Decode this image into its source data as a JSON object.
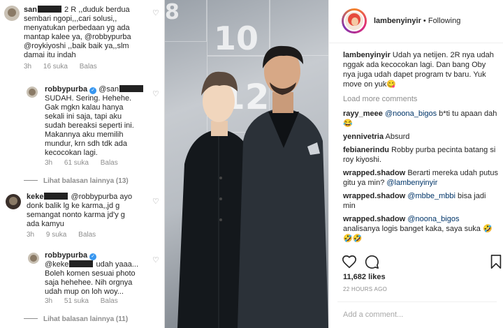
{
  "left_comments": [
    {
      "user_prefix": "san",
      "text_after_user": "2 R ,,duduk berdua",
      "lines": [
        "sembari ngopi,,,cari solusi,,",
        "menyatukan perbedaan yg ada",
        "mantap kalee ya, @robbypurba",
        "@roykiyoshi ,,baik baik ya,,slm",
        "damai itu indah"
      ],
      "time": "3h",
      "likes": "16 suka",
      "reply": "Balas"
    },
    {
      "user": "robbypurba",
      "mention_prefix": "@san",
      "lines": [
        "SUDAH. Sering. Hehehe.",
        "Gak mgkn kalau hanya",
        "sekali ini saja, tapi aku",
        "sudah bereaksi seperti ini.",
        "Makannya aku memilih",
        "mundur, krn sdh tdk ada",
        "kecocokan lagi."
      ],
      "time": "3h",
      "likes": "61 suka",
      "reply": "Balas"
    },
    {
      "more_replies": "Lihat balasan lainnya (13)"
    },
    {
      "user_prefix": "keke",
      "text_after_user": "@robbypurba ayo",
      "lines": [
        "donk balik lg ke karma,,jd g",
        "semangat nonto karma jd'y g",
        "ada kamyu"
      ],
      "time": "3h",
      "likes": "9 suka",
      "reply": "Balas"
    },
    {
      "user": "robbypurba",
      "mention_prefix": "@keke",
      "mention_suffix": "udah yaaa...",
      "lines": [
        "Boleh komen sesuai photo",
        "saja hehehee. Nih orgnya",
        "udah mup on loh woy..."
      ],
      "time": "3h",
      "likes": "51 suka",
      "reply": "Balas"
    },
    {
      "more_replies": "Lihat balasan lainnya (11)"
    }
  ],
  "photo": {
    "numbers": [
      "8",
      "10",
      "12"
    ]
  },
  "post": {
    "username": "lambenyinyir",
    "follow_status": "Following",
    "caption_user": "lambenyinyir",
    "caption_text": "Udah ya netijen. 2R nya udah nggak ada kecocokan lagi. Dan bang Oby nya juga udah dapet program tv baru. Yuk move on yuk😋",
    "load_more": "Load more comments",
    "comments": [
      {
        "user": "rayy_meee",
        "mention": "@noona_bigos",
        "text": " b*ti tu apaan dah😂"
      },
      {
        "user": "yennivetria",
        "mention": "",
        "text": "Absurd"
      },
      {
        "user": "febianerindu",
        "mention": "",
        "text": "Robby purba pecinta batang si roy kiyoshi."
      },
      {
        "user": "wrapped.shadow",
        "mention": "",
        "text": "Berarti mereka udah putus gitu ya min?",
        "mention_after": " @lambenyinyir"
      },
      {
        "user": "wrapped.shadow",
        "mention": "@mbbe_mbbi",
        "text": " bisa jadi min"
      },
      {
        "user": "wrapped.shadow",
        "mention": "@noona_bigos",
        "text": " analisanya logis banget kaka, saya suka 🤣🤣🤣"
      }
    ],
    "likes": "11,682 likes",
    "time_ago": "22 HOURS AGO",
    "comment_placeholder": "Add a comment..."
  }
}
